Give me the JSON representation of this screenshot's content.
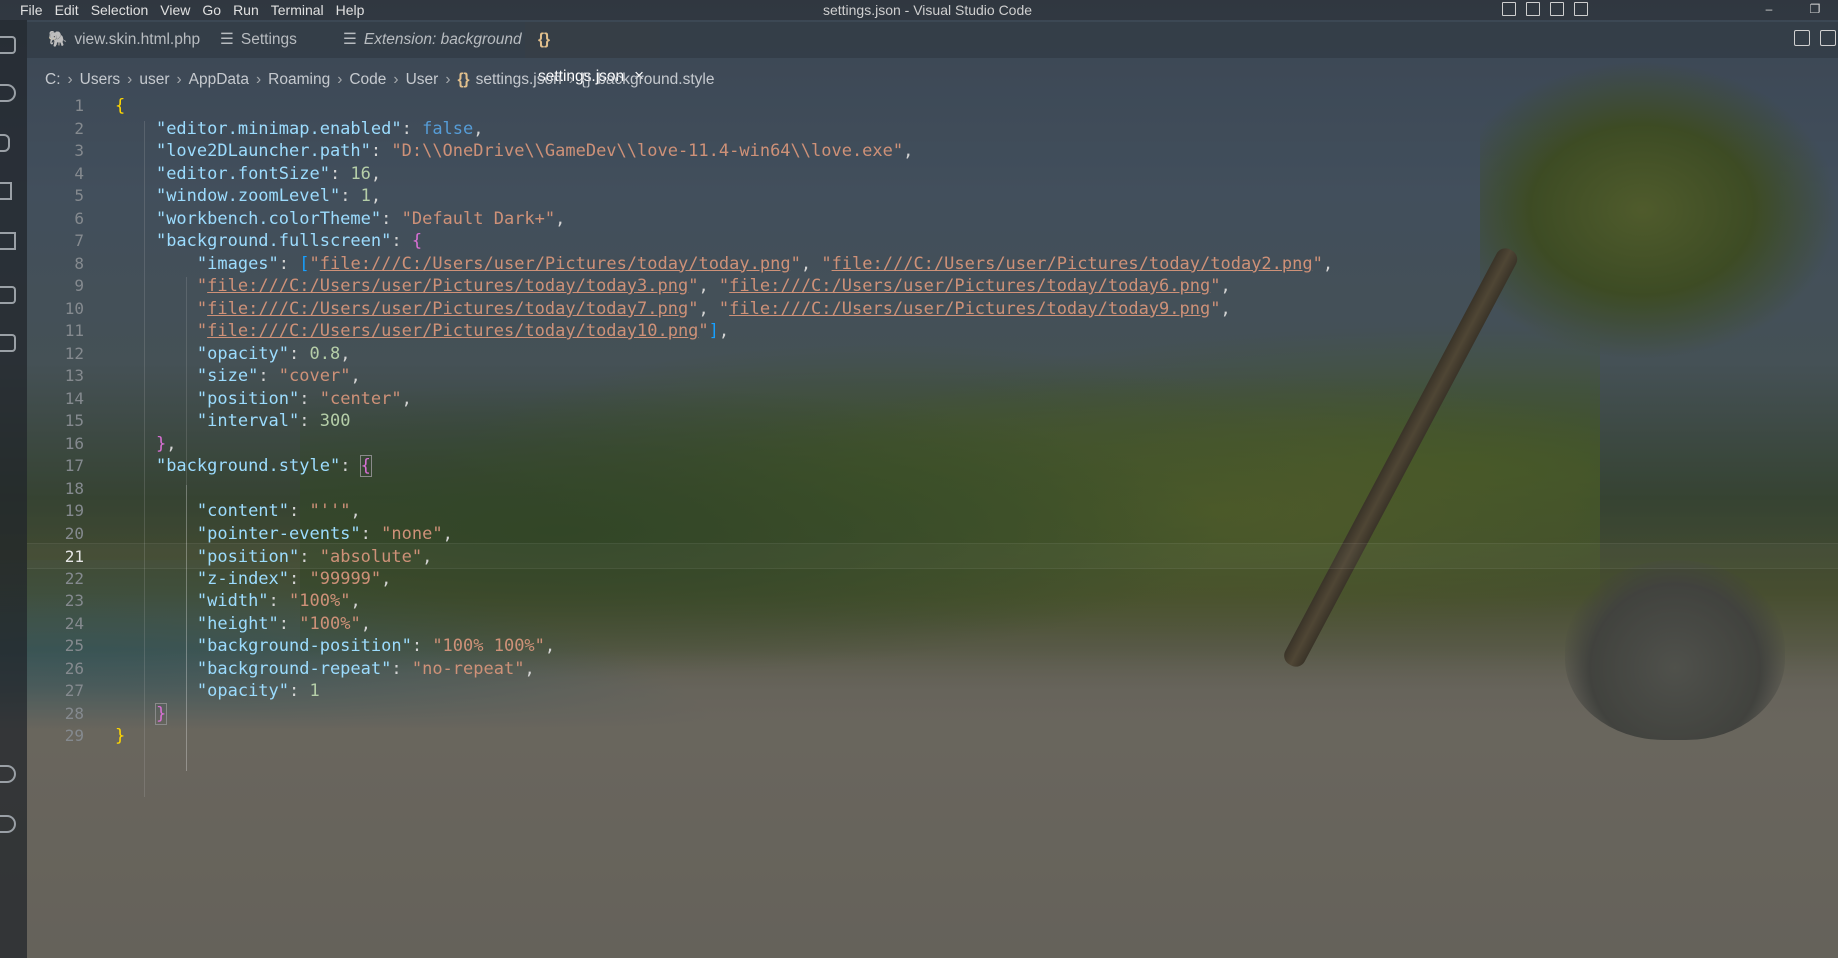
{
  "window": {
    "title": "settings.json - Visual Studio Code"
  },
  "menu": [
    "File",
    "Edit",
    "Selection",
    "View",
    "Go",
    "Run",
    "Terminal",
    "Help"
  ],
  "window_controls": {
    "minimize": "–",
    "restore": "❐"
  },
  "tabs": [
    {
      "label": "view.skin.html.php",
      "icon": "php-icon",
      "active": false,
      "italic": false
    },
    {
      "label": "Settings",
      "icon": "settings-list-icon",
      "active": false,
      "italic": false
    },
    {
      "label": "Extension: background",
      "icon": "extension-list-icon",
      "active": false,
      "italic": true
    },
    {
      "label": "settings.json",
      "icon": "json-braces-icon",
      "active": true,
      "italic": false,
      "close": "×"
    }
  ],
  "breadcrumb": [
    "C:",
    "Users",
    "user",
    "AppData",
    "Roaming",
    "Code",
    "User",
    "settings.json",
    "background.style"
  ],
  "editor": {
    "current_line": 21,
    "lines": [
      {
        "n": "1",
        "text": "{"
      },
      {
        "n": "2",
        "text": "    \"editor.minimap.enabled\": false,"
      },
      {
        "n": "3",
        "text": "    \"love2DLauncher.path\": \"D:\\\\OneDrive\\\\GameDev\\\\love-11.4-win64\\\\love.exe\","
      },
      {
        "n": "4",
        "text": "    \"editor.fontSize\": 16,"
      },
      {
        "n": "5",
        "text": "    \"window.zoomLevel\": 1,"
      },
      {
        "n": "6",
        "text": "    \"workbench.colorTheme\": \"Default Dark+\","
      },
      {
        "n": "7",
        "text": "    \"background.fullscreen\": {"
      },
      {
        "n": "8",
        "text": "        \"images\": [\"file:///C:/Users/user/Pictures/today/today.png\", \"file:///C:/Users/user/Pictures/today/today2.png\","
      },
      {
        "n": "9",
        "text": "        \"file:///C:/Users/user/Pictures/today/today3.png\", \"file:///C:/Users/user/Pictures/today/today6.png\","
      },
      {
        "n": "10",
        "text": "        \"file:///C:/Users/user/Pictures/today/today7.png\", \"file:///C:/Users/user/Pictures/today/today9.png\","
      },
      {
        "n": "11",
        "text": "        \"file:///C:/Users/user/Pictures/today/today10.png\"],"
      },
      {
        "n": "12",
        "text": "        \"opacity\": 0.8,"
      },
      {
        "n": "13",
        "text": "        \"size\": \"cover\","
      },
      {
        "n": "14",
        "text": "        \"position\": \"center\","
      },
      {
        "n": "15",
        "text": "        \"interval\": 300"
      },
      {
        "n": "16",
        "text": "    },"
      },
      {
        "n": "17",
        "text": "    \"background.style\": {"
      },
      {
        "n": "18",
        "text": ""
      },
      {
        "n": "19",
        "text": "        \"content\": \"''\","
      },
      {
        "n": "20",
        "text": "        \"pointer-events\": \"none\","
      },
      {
        "n": "21",
        "text": "        \"position\": \"absolute\","
      },
      {
        "n": "22",
        "text": "        \"z-index\": \"99999\","
      },
      {
        "n": "23",
        "text": "        \"width\": \"100%\","
      },
      {
        "n": "24",
        "text": "        \"height\": \"100%\","
      },
      {
        "n": "25",
        "text": "        \"background-position\": \"100% 100%\","
      },
      {
        "n": "26",
        "text": "        \"background-repeat\": \"no-repeat\","
      },
      {
        "n": "27",
        "text": "        \"opacity\": 1"
      },
      {
        "n": "28",
        "text": "    }"
      },
      {
        "n": "29",
        "text": "}"
      }
    ]
  },
  "colors": {
    "key": "#9cdcfe",
    "string": "#ce9178",
    "boolean": "#569cd6",
    "number": "#b5cea8",
    "brace_level1": "#ffd700",
    "brace_level2": "#da70d6",
    "brace_level3": "#179fff"
  }
}
